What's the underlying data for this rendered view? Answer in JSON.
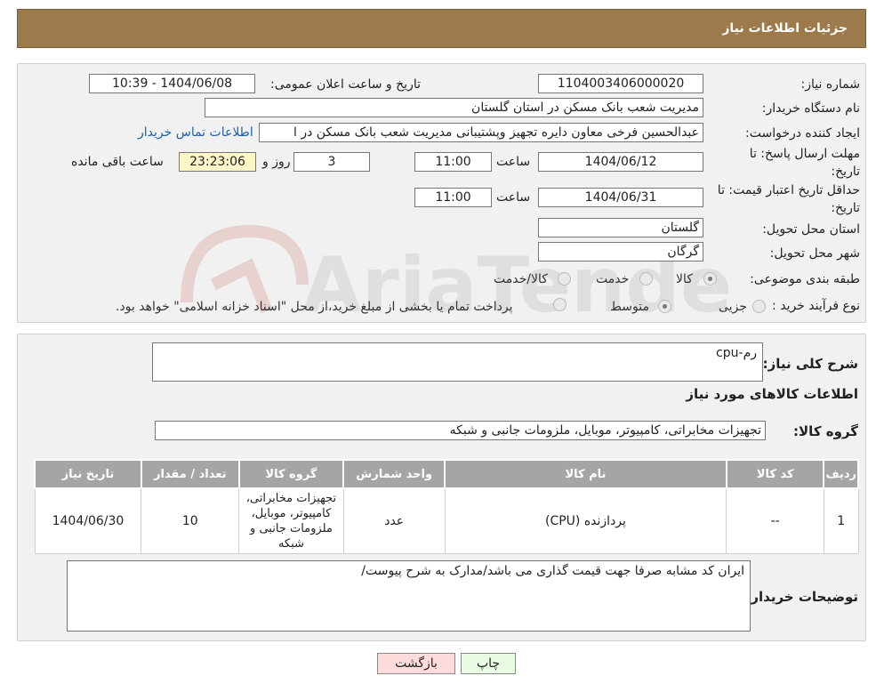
{
  "header": {
    "title": "جزئیات اطلاعات نیاز"
  },
  "form": {
    "need_number": {
      "label": "شماره نیاز:",
      "value": "1104003406000020"
    },
    "announce_datetime": {
      "label": "تاریخ و ساعت اعلان عمومی:",
      "value": "1404/06/08 - 10:39"
    },
    "buyer_org": {
      "label": "نام دستگاه خریدار:",
      "value": "مدیریت شعب بانک مسکن در استان گلستان"
    },
    "requester": {
      "label": "ایجاد کننده درخواست:",
      "value": "عبدالحسین فرخی معاون دایره تجهیز وپشتیبانی مدیریت شعب بانک مسکن در ا",
      "contact_link": "اطلاعات تماس خریدار"
    },
    "send_deadline": {
      "label": "مهلت ارسال پاسخ: تا تاریخ:",
      "date": "1404/06/12",
      "time_label": "ساعت",
      "time": "11:00",
      "days": "3",
      "days_label": "روز و",
      "remaining": "23:23:06",
      "remaining_label": "ساعت باقی مانده"
    },
    "price_validity": {
      "label": "حداقل تاریخ اعتبار قیمت: تا تاریخ:",
      "date": "1404/06/31",
      "time_label": "ساعت",
      "time": "11:00"
    },
    "delivery_province": {
      "label": "استان محل تحویل:",
      "value": "گلستان"
    },
    "delivery_city": {
      "label": "شهر محل تحویل:",
      "value": "گرگان"
    },
    "category": {
      "label": "طبقه بندی موضوعی:",
      "options": [
        "کالا",
        "خدمت",
        "کالا/خدمت"
      ],
      "selected": "کالا"
    },
    "purchase_type": {
      "label": "نوع فرآیند خرید :",
      "options": [
        "جزیی",
        "متوسط"
      ],
      "note": "پرداخت تمام یا بخشی از مبلغ خرید،از محل \"اسناد خزانه اسلامی\" خواهد بود.",
      "selected": "متوسط"
    }
  },
  "description": {
    "label": "شرح کلی نیاز:",
    "value": "رم-cpu"
  },
  "goods_section_title": "اطلاعات کالاهای مورد نیاز",
  "goods_group": {
    "label": "گروه کالا:",
    "value": "تجهیزات مخابراتی، کامپیوتر، موبایل، ملزومات جانبی و شبکه"
  },
  "table": {
    "headers": [
      "ردیف",
      "کد کالا",
      "نام کالا",
      "واحد شمارش",
      "گروه کالا",
      "تعداد / مقدار",
      "تاریخ نیاز"
    ],
    "rows": [
      [
        "1",
        "--",
        "پردازنده (CPU)",
        "عدد",
        "تجهیزات مخابراتی، کامپیوتر، موبایل، ملزومات جانبی و شبکه",
        "10",
        "1404/06/30"
      ]
    ]
  },
  "buyer_notes": {
    "label": "توضیحات خریدار:",
    "value": "ایران کد مشابه صرفا جهت قیمت گذاری می باشد/مدارک به شرح پیوست/"
  },
  "buttons": {
    "print": "چاپ",
    "back": "بازگشت"
  },
  "watermark_text": "AriaTender.neT",
  "colors": {
    "header": "#9c7a4b",
    "table_header": "#a5a5a5",
    "back_button": "#ffdcdc",
    "print_button": "#eafbe3",
    "link": "#1a5fb4",
    "highlight": "#fff6c8"
  }
}
